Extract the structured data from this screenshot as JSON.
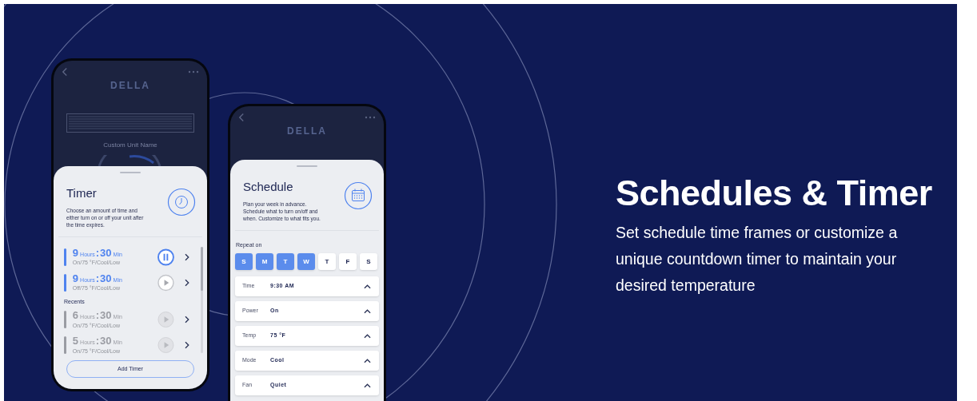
{
  "timer_phone": {
    "brand": "DELLA",
    "unit_name": "Custom Unit Name",
    "sheet": {
      "title": "Timer",
      "description": "Choose an amount of time and either turn on or off your unit after the time expires.",
      "timers": [
        {
          "hours": "9",
          "hours_label": "Hours",
          "separator": ":",
          "minutes": "30",
          "minutes_label": "Min",
          "settings": "On/75 °F/Cool/Low",
          "active": true,
          "running": true
        },
        {
          "hours": "9",
          "hours_label": "Hours",
          "separator": ":",
          "minutes": "30",
          "minutes_label": "Min",
          "settings": "Off/75 °F/Cool/Low",
          "active": true,
          "running": false
        }
      ],
      "recents_label": "Recents",
      "recents": [
        {
          "hours": "6",
          "hours_label": "Hours",
          "separator": ":",
          "minutes": "30",
          "minutes_label": "Min",
          "settings": "On/75 °F/Cool/Low",
          "active": false,
          "running": false
        },
        {
          "hours": "5",
          "hours_label": "Hours",
          "separator": ":",
          "minutes": "30",
          "minutes_label": "Min",
          "settings": "On/75 °F/Cool/Low",
          "active": false,
          "running": false
        }
      ],
      "add_button": "Add Timer"
    }
  },
  "schedule_phone": {
    "brand": "DELLA",
    "sheet": {
      "title": "Schedule",
      "description": "Plan your week in advance. Schedule what to turn on/off and when. Customize to what fits you.",
      "repeat_label": "Repeat on",
      "days": [
        {
          "label": "S",
          "selected": true
        },
        {
          "label": "M",
          "selected": true
        },
        {
          "label": "T",
          "selected": true
        },
        {
          "label": "W",
          "selected": true
        },
        {
          "label": "T",
          "selected": false
        },
        {
          "label": "F",
          "selected": false
        },
        {
          "label": "S",
          "selected": false
        }
      ],
      "settings": [
        {
          "label": "Time",
          "value": "9:30 AM"
        },
        {
          "label": "Power",
          "value": "On"
        },
        {
          "label": "Temp",
          "value": "75 °F"
        },
        {
          "label": "Mode",
          "value": "Cool"
        },
        {
          "label": "Fan",
          "value": "Quiet"
        }
      ]
    }
  },
  "headline": "Schedules & Timer",
  "subtitle": "Set schedule time frames or customize a unique countdown timer to maintain your desired temperature"
}
